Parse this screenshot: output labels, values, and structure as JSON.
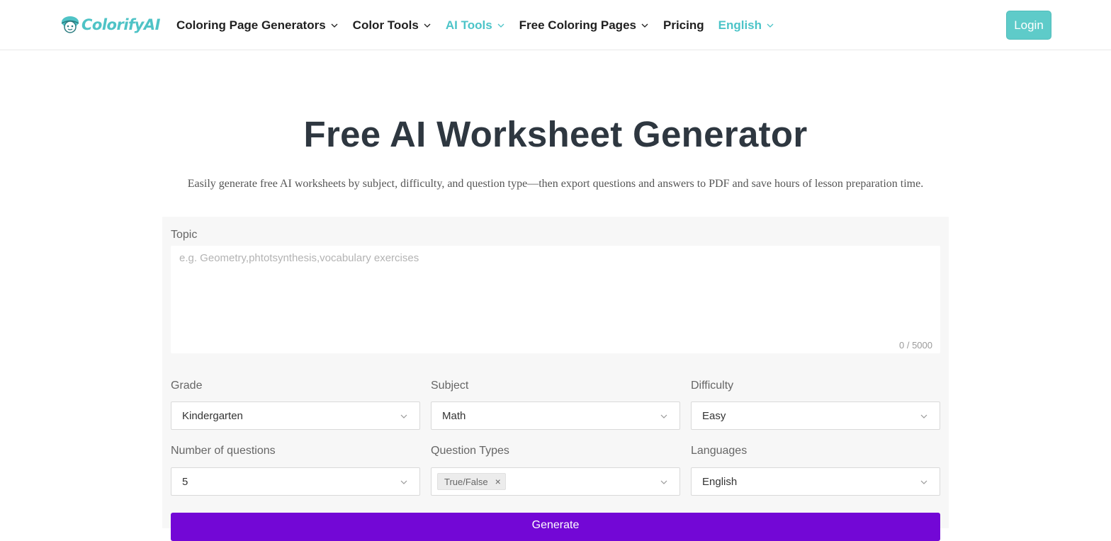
{
  "header": {
    "logo_text": "ColorifyAI",
    "nav": [
      {
        "label": "Coloring Page Generators",
        "has_dropdown": true
      },
      {
        "label": "Color Tools",
        "has_dropdown": true
      },
      {
        "label": "AI Tools",
        "has_dropdown": true,
        "active": true
      },
      {
        "label": "Free Coloring Pages",
        "has_dropdown": true
      },
      {
        "label": "Pricing",
        "has_dropdown": false
      },
      {
        "label": "English",
        "has_dropdown": true
      }
    ],
    "login_label": "Login"
  },
  "hero": {
    "title": "Free AI Worksheet Generator",
    "subtitle": "Easily generate free AI worksheets by subject, difficulty, and question type—then export questions and answers to PDF and save hours of lesson preparation time."
  },
  "form": {
    "topic_label": "Topic",
    "topic_placeholder": "e.g. Geometry,phtotsynthesis,vocabulary exercises",
    "topic_value": "",
    "topic_counter": "0 / 5000",
    "grade_label": "Grade",
    "grade_value": "Kindergarten",
    "subject_label": "Subject",
    "subject_value": "Math",
    "difficulty_label": "Difficulty",
    "difficulty_value": "Easy",
    "questions_label": "Number of questions",
    "questions_value": "5",
    "types_label": "Question Types",
    "types_tags": [
      "True/False"
    ],
    "languages_label": "Languages",
    "languages_value": "English",
    "generate_label": "Generate"
  },
  "colors": {
    "accent": "#4cc4c8",
    "login_bg": "#5ecbc9",
    "generate_bg": "#7307d6",
    "title": "#2e3740"
  }
}
